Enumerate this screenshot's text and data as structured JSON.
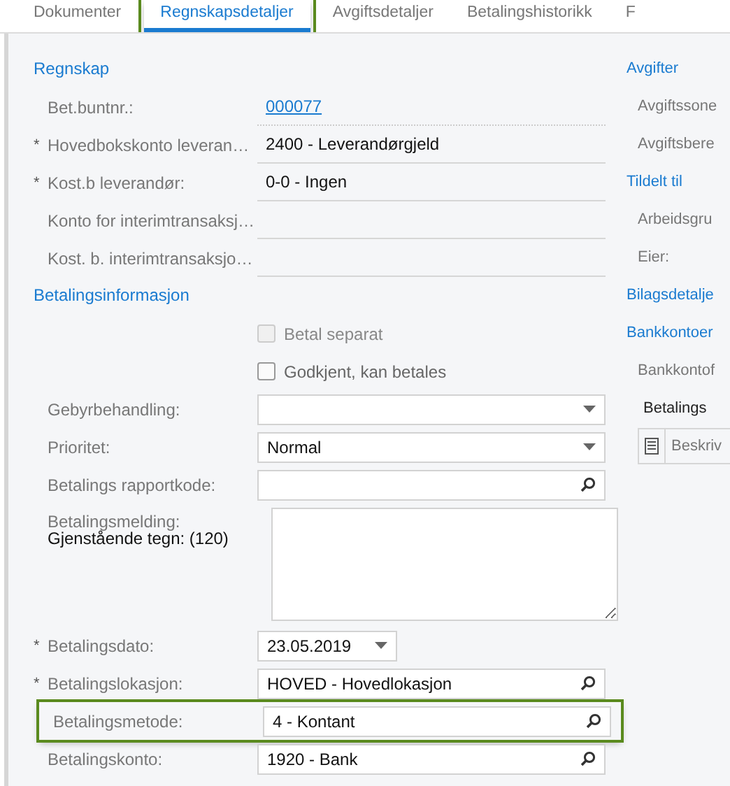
{
  "tabs": [
    {
      "label": "Dokumenter",
      "selected": false,
      "highlighted": false
    },
    {
      "label": "Regnskapsdetaljer",
      "selected": true,
      "highlighted": true
    },
    {
      "label": "Avgiftsdetaljer",
      "selected": false,
      "highlighted": false
    },
    {
      "label": "Betalingshistorikk",
      "selected": false,
      "highlighted": false
    },
    {
      "label": "F",
      "selected": false,
      "highlighted": false
    }
  ],
  "left": [
    {
      "kind": "heading",
      "text": "Regnskap"
    },
    {
      "kind": "link",
      "label": "Bet.buntnr.:",
      "value": "000077"
    },
    {
      "kind": "text",
      "label": "Hovedbokskonto leveran…",
      "required_mark": "*",
      "value": "2400 - Leverandørgjeld"
    },
    {
      "kind": "text",
      "label": "Kost.b leverandør:",
      "required_mark": "*",
      "value": "0-0 - Ingen"
    },
    {
      "kind": "text",
      "label": "Konto for interimtransaksj…"
    },
    {
      "kind": "text",
      "label": "Kost. b. interimtransaksjo…"
    },
    {
      "kind": "heading",
      "text": "Betalingsinformasjon"
    },
    {
      "kind": "checkbox",
      "text": "Betal separat",
      "checked": false,
      "disabled": true
    },
    {
      "kind": "checkbox",
      "text": "Godkjent, kan betales",
      "checked": false,
      "disabled": false
    },
    {
      "kind": "select",
      "label": "Gebyrbehandling:"
    },
    {
      "kind": "select",
      "label": "Prioritet:",
      "value": "Normal"
    },
    {
      "kind": "lookup",
      "label": "Betalings rapportkode:"
    },
    {
      "kind": "textarea",
      "label": "Betalingsmelding:",
      "counter": "Gjenstående tegn: (120)"
    },
    {
      "kind": "date",
      "label": "Betalingsdato:",
      "required_mark": "*",
      "value": "23.05.2019"
    },
    {
      "kind": "lookup",
      "label": "Betalingslokasjon:",
      "required_mark": "*",
      "value": "HOVED - Hovedlokasjon"
    },
    {
      "kind": "lookup",
      "label": "Betalingsmetode:",
      "value": "4 - Kontant",
      "highlighted": true
    },
    {
      "kind": "lookup",
      "label": "Betalingskonto:",
      "value": "1920 - Bank"
    }
  ],
  "right": [
    {
      "kind": "heading",
      "text": "Avgifter"
    },
    {
      "kind": "label",
      "text": "Avgiftssone"
    },
    {
      "kind": "label",
      "text": "Avgiftsbere"
    },
    {
      "kind": "heading",
      "text": "Tildelt til"
    },
    {
      "kind": "label",
      "text": "Arbeidsgru"
    },
    {
      "kind": "label",
      "text": "Eier:"
    },
    {
      "kind": "heading",
      "text": "Bilagsdetalje"
    },
    {
      "kind": "heading",
      "text": "Bankkontoer"
    },
    {
      "kind": "label",
      "text": "Bankkontof"
    },
    {
      "kind": "title",
      "text": "Betalings"
    },
    {
      "kind": "grid",
      "column": "Beskriv"
    }
  ]
}
